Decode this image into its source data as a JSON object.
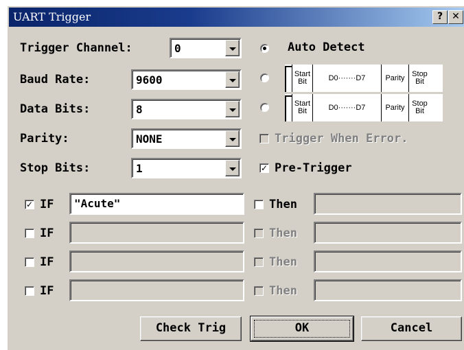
{
  "window": {
    "title": "UART Trigger",
    "help_glyph": "?",
    "close_glyph": "✕"
  },
  "settings": {
    "trigger_channel": {
      "label": "Trigger Channel:",
      "value": "0"
    },
    "baud_rate": {
      "label": "Baud Rate:",
      "value": "9600"
    },
    "data_bits": {
      "label": "Data Bits:",
      "value": "8"
    },
    "parity": {
      "label": "Parity:",
      "value": "NONE"
    },
    "stop_bits": {
      "label": "Stop Bits:",
      "value": "1"
    }
  },
  "format": {
    "auto_detect_label": "Auto Detect",
    "selected": "auto_detect",
    "frame": {
      "start_top": "Start",
      "start_bottom": "Bit",
      "data": "D0·······D7",
      "parity": "Parity",
      "stop_top": "Stop",
      "stop_bottom": "Bit"
    }
  },
  "options": {
    "trigger_when_error": {
      "label": "Trigger When Error.",
      "checked": false,
      "enabled": false
    },
    "pre_trigger": {
      "label": "Pre-Trigger",
      "checked": true,
      "enabled": true
    }
  },
  "conditions": [
    {
      "if_label": "IF",
      "if_checked": true,
      "if_value": "\"Acute\"",
      "then_label": "Then",
      "then_checked": false,
      "then_enabled": true,
      "then_value": ""
    },
    {
      "if_label": "IF",
      "if_checked": false,
      "if_value": "",
      "then_label": "Then",
      "then_checked": false,
      "then_enabled": false,
      "then_value": ""
    },
    {
      "if_label": "IF",
      "if_checked": false,
      "if_value": "",
      "then_label": "Then",
      "then_checked": false,
      "then_enabled": false,
      "then_value": ""
    },
    {
      "if_label": "IF",
      "if_checked": false,
      "if_value": "",
      "then_label": "Then",
      "then_checked": false,
      "then_enabled": false,
      "then_value": ""
    }
  ],
  "buttons": {
    "check_trig": "Check Trig",
    "ok": "OK",
    "cancel": "Cancel"
  },
  "colors": {
    "dialog_face": "#d4d0c8",
    "title_start": "#0a246a",
    "title_end": "#a6caf0",
    "disabled_text": "#808080"
  }
}
